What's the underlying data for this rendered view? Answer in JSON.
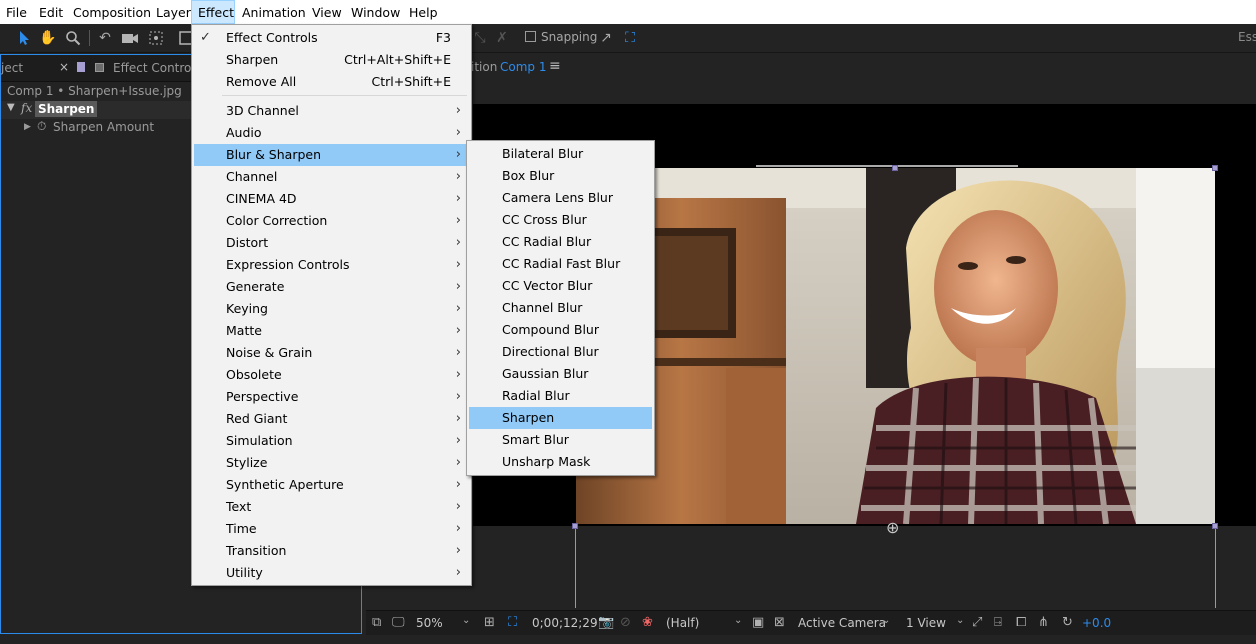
{
  "menubar": {
    "items": [
      "File",
      "Edit",
      "Composition",
      "Layer",
      "Effect",
      "Animation",
      "View",
      "Window",
      "Help"
    ],
    "active": "Effect"
  },
  "toolbar": {
    "snapping_label": "Snapping",
    "workspace_label": "Ess"
  },
  "left_panel": {
    "project_tab": "ject",
    "tab_label": "Effect Controls",
    "breadcrumb": "Comp 1 • Sharpen+Issue.jpg",
    "effect_name": "Sharpen",
    "fx_label": "fx",
    "property_label": "Sharpen Amount"
  },
  "comp_panel": {
    "tab_prefix": "ition",
    "comp_name": "Comp 1"
  },
  "effect_menu": {
    "items": [
      {
        "label": "Effect Controls",
        "shortcut": "F3",
        "checked": true
      },
      {
        "label": "Sharpen",
        "shortcut": "Ctrl+Alt+Shift+E"
      },
      {
        "label": "Remove All",
        "shortcut": "Ctrl+Shift+E"
      },
      {
        "label": "3D Channel"
      },
      {
        "label": "Audio"
      },
      {
        "label": "Blur & Sharpen",
        "highlighted": true
      },
      {
        "label": "Channel"
      },
      {
        "label": "CINEMA 4D"
      },
      {
        "label": "Color Correction"
      },
      {
        "label": "Distort"
      },
      {
        "label": "Expression Controls"
      },
      {
        "label": "Generate"
      },
      {
        "label": "Keying"
      },
      {
        "label": "Matte"
      },
      {
        "label": "Noise & Grain"
      },
      {
        "label": "Obsolete"
      },
      {
        "label": "Perspective"
      },
      {
        "label": "Red Giant"
      },
      {
        "label": "Simulation"
      },
      {
        "label": "Stylize"
      },
      {
        "label": "Synthetic Aperture"
      },
      {
        "label": "Text"
      },
      {
        "label": "Time"
      },
      {
        "label": "Transition"
      },
      {
        "label": "Utility"
      }
    ],
    "check_icon": "check-icon",
    "arrow_icon": "chevron-right-icon"
  },
  "blur_submenu": {
    "items": [
      "Bilateral Blur",
      "Box Blur",
      "Camera Lens Blur",
      "CC Cross Blur",
      "CC Radial Blur",
      "CC Radial Fast Blur",
      "CC Vector Blur",
      "Channel Blur",
      "Compound Blur",
      "Directional Blur",
      "Gaussian Blur",
      "Radial Blur",
      "Sharpen",
      "Smart Blur",
      "Unsharp Mask"
    ],
    "highlighted": "Sharpen"
  },
  "status_bar": {
    "zoom": "50%",
    "timecode": "0;00;12;29",
    "resolution": "(Half)",
    "camera": "Active Camera",
    "views": "1 View",
    "exposure": "+0.0"
  },
  "colors": {
    "accent": "#2d8ceb",
    "menu_highlight": "#91c9f7",
    "menubar_active": "#cce8ff",
    "panel_bg": "#232323",
    "menu_bg": "#f2f2f2"
  }
}
